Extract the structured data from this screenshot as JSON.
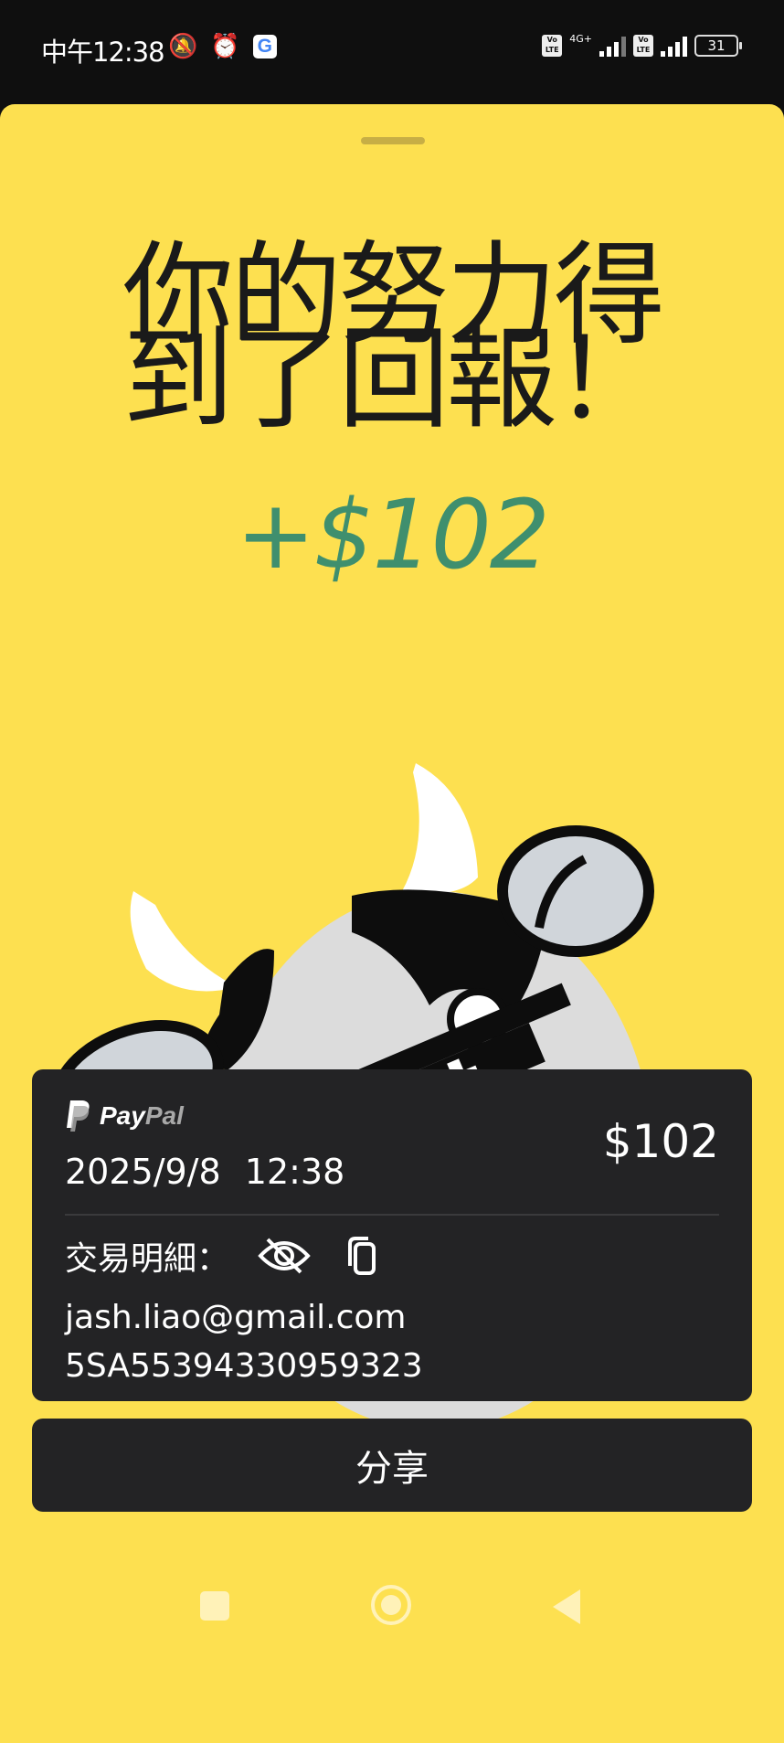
{
  "status_bar": {
    "time": "中午12:38",
    "icons": [
      "vibrate-off-icon",
      "alarm-icon",
      "google-icon"
    ],
    "network": "4G+",
    "volte": "Vo LTE",
    "battery": "31"
  },
  "headline": {
    "line1": "你的努力得",
    "line2": "到了回報！"
  },
  "reward_amount": "+$102",
  "card": {
    "brand_pay": "Pay",
    "brand_pal": "Pal",
    "amount": "$102",
    "date": "2025/9/8",
    "time": "12:38",
    "details_label": "交易明細：",
    "email": "jash.liao@gmail.com",
    "transaction_id": "5SA55394330959323"
  },
  "share_label": "分享",
  "colors": {
    "accent_yellow": "#fde050",
    "reward_green": "#3f8f6e",
    "card_dark": "#232325"
  }
}
